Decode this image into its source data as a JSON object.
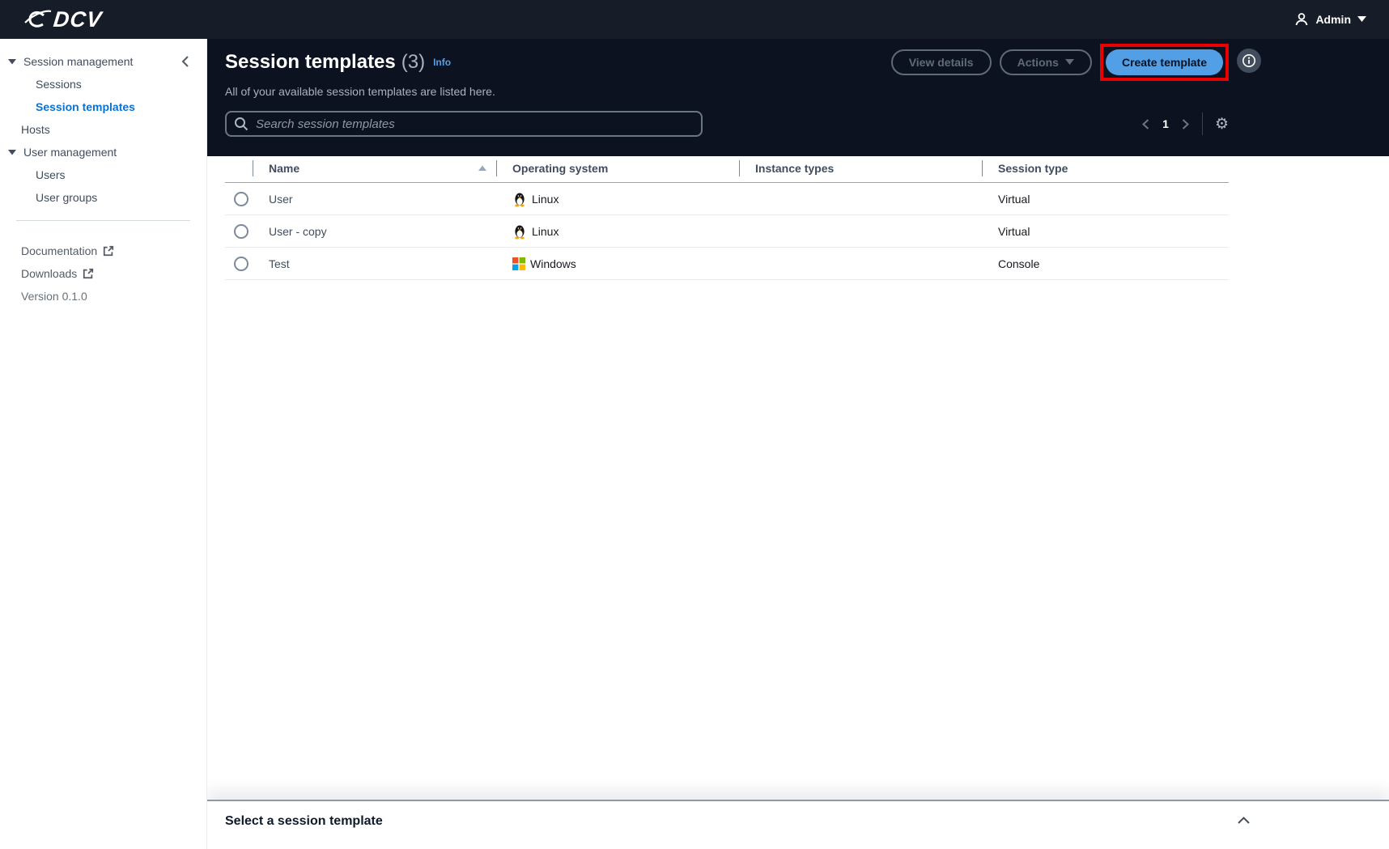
{
  "topbar": {
    "brand": "DCV",
    "user_label": "Admin"
  },
  "sidebar": {
    "items": [
      {
        "label": "Session management",
        "type": "section"
      },
      {
        "label": "Sessions",
        "type": "child"
      },
      {
        "label": "Session templates",
        "type": "child",
        "active": true
      },
      {
        "label": "Hosts",
        "type": "toplevel"
      },
      {
        "label": "User management",
        "type": "section"
      },
      {
        "label": "Users",
        "type": "child"
      },
      {
        "label": "User groups",
        "type": "child"
      }
    ],
    "footer_links": [
      {
        "label": "Documentation",
        "external": true
      },
      {
        "label": "Downloads",
        "external": true
      }
    ],
    "version": "Version 0.1.0"
  },
  "header": {
    "title": "Session templates",
    "count": "(3)",
    "info_label": "Info",
    "subtitle": "All of your available session templates are listed here.",
    "buttons": {
      "view_details": "View details",
      "actions": "Actions",
      "create": "Create template"
    }
  },
  "toolbar": {
    "search_placeholder": "Search session templates",
    "page_number": "1"
  },
  "table": {
    "columns": [
      "Name",
      "Operating system",
      "Instance types",
      "Session type"
    ],
    "rows": [
      {
        "name": "User",
        "os": "Linux",
        "os_icon": "linux-tux",
        "instance_types": "",
        "session_type": "Virtual"
      },
      {
        "name": "User - copy",
        "os": "Linux",
        "os_icon": "linux-tux",
        "instance_types": "",
        "session_type": "Virtual"
      },
      {
        "name": "Test",
        "os": "Windows",
        "os_icon": "windows-logo",
        "instance_types": "",
        "session_type": "Console"
      }
    ]
  },
  "bottom_panel": {
    "title": "Select a session template"
  },
  "icons": {
    "gear": "⚙"
  },
  "colors": {
    "topbar_bg": "#161d28",
    "header_bg": "#0c121f",
    "primary_button_blue": "#539fe5",
    "active_link_blue": "#0972d3",
    "info_link_blue": "#539fe5",
    "annotation_red": "#ea0000",
    "windows_red": "#f25022",
    "windows_green": "#7fba00",
    "windows_blue": "#00a4ef",
    "windows_yellow": "#ffb900"
  }
}
